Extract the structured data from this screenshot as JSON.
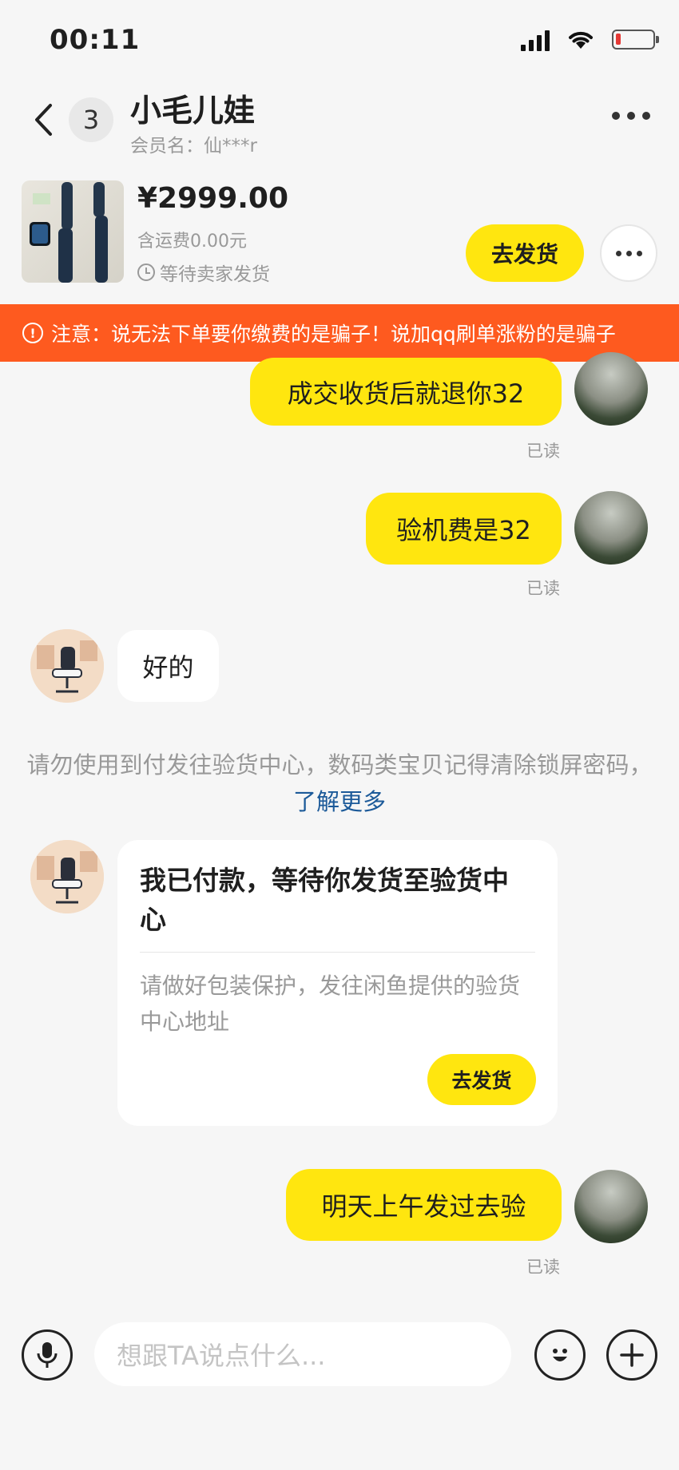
{
  "status_bar": {
    "time": "00:11"
  },
  "header": {
    "unread_count": "3",
    "peer_name": "小毛儿娃",
    "member_label": "会员名：仙***r"
  },
  "item_card": {
    "price": "¥2999.00",
    "shipping": "含运费0.00元",
    "order_status": "等待卖家发货",
    "ship_button": "去发货"
  },
  "warning": {
    "text": "注意：说无法下单要你缴费的是骗子！说加qq刷单涨粉的是骗子"
  },
  "messages": [
    {
      "from": "me",
      "text": "成交收货后就退你32",
      "read": "已读"
    },
    {
      "from": "me",
      "text": "验机费是32",
      "read": "已读"
    },
    {
      "from": "peer",
      "text": "好的"
    },
    {
      "from": "system",
      "text": "请勿使用到付发往验货中心，数码类宝贝记得清除锁屏密码，",
      "link": "了解更多"
    },
    {
      "from": "peer",
      "card_title": "我已付款，等待你发货至验货中心",
      "card_desc": "请做好包装保护，发往闲鱼提供的验货中心地址",
      "card_button": "去发货"
    },
    {
      "from": "me",
      "text": "明天上午发过去验",
      "read": "已读"
    }
  ],
  "composer": {
    "placeholder": "想跟TA说点什么..."
  },
  "colors": {
    "accent": "#ffe60f",
    "warning": "#fe5a1f",
    "link": "#1c5a99"
  }
}
